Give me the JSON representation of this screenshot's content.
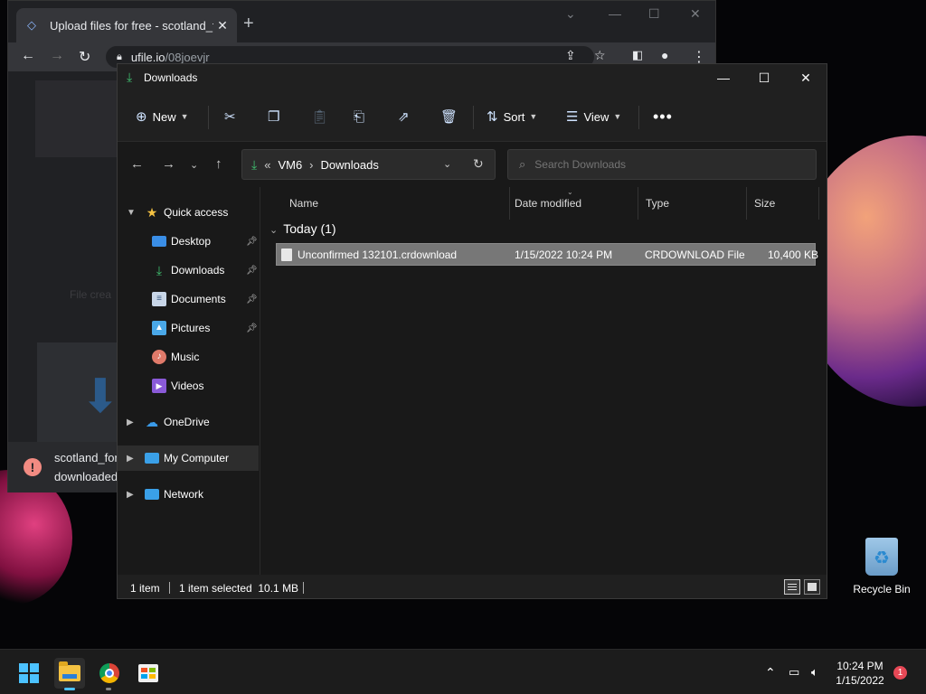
{
  "browser": {
    "tab_title": "Upload files for free - scotland_fo",
    "url_host": "ufile.io",
    "url_path": "/08joevjr",
    "page_text": "File crea",
    "download": {
      "line1": "scotland_for",
      "line2": "downloaded"
    }
  },
  "explorer": {
    "title": "Downloads",
    "toolbar": {
      "new_label": "New",
      "sort_label": "Sort",
      "view_label": "View"
    },
    "breadcrumb": {
      "overflow": "«",
      "segment1": "VM6",
      "separator": "›",
      "segment2": "Downloads"
    },
    "search": {
      "placeholder": "Search Downloads"
    },
    "nav": {
      "quick_access": "Quick access",
      "desktop": "Desktop",
      "downloads": "Downloads",
      "documents": "Documents",
      "pictures": "Pictures",
      "music": "Music",
      "videos": "Videos",
      "onedrive": "OneDrive",
      "my_computer": "My Computer",
      "network": "Network"
    },
    "columns": {
      "name": "Name",
      "date": "Date modified",
      "type": "Type",
      "size": "Size"
    },
    "group_label": "Today (1)",
    "files": [
      {
        "name": "Unconfirmed 132101.crdownload",
        "date": "1/15/2022 10:24 PM",
        "type": "CRDOWNLOAD File",
        "size": "10,400 KB"
      }
    ],
    "status": {
      "count": "1 item",
      "selected": "1 item selected  10.1 MB"
    }
  },
  "desktop": {
    "recycle_bin": "Recycle Bin"
  },
  "taskbar": {
    "time": "10:24 PM",
    "date": "1/15/2022",
    "notifications": "1"
  },
  "colors": {
    "accent": "#4cc2ff",
    "download_green": "#3fbf6f",
    "selection": "#777777"
  }
}
